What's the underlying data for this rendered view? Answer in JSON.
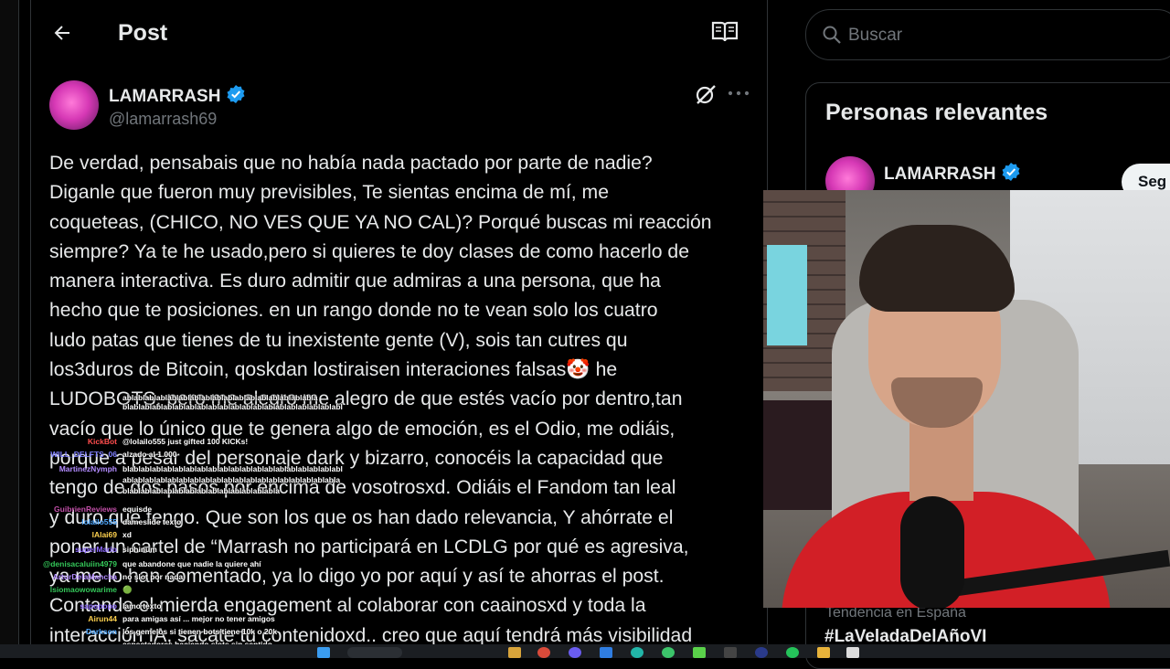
{
  "header": {
    "title": "Post"
  },
  "author": {
    "name": "LAMARRASH",
    "handle": "@lamarrash69"
  },
  "tweet": {
    "lines": [
      "De verdad, pensabais que no había nada pactado por parte  de  nadie?",
      "Diganle que fueron muy previsibles, Te sientas encima de mí, me",
      "coqueteas, (CHICO, NO VES QUE YA NO CAL)? Porqué buscas mi reacción",
      "siempre? Ya te he usado,pero si quieres te doy clases de como hacerlo de",
      "manera interactiva. Es duro admitir que admiras a una persona, que ha",
      "hecho que te posiciones. en un rango donde no te vean solo los cuatro",
      "ludo patas que tienes  de tu inexistente gente (V), sois tan cutres qu",
      "los3duros de Bitcoin, qoskdan  lostiraisen interaciones falsas🤡 he",
      "LUDOBOTS, pero me alegro me alegro de que estés vacío por dentro,tan",
      "vacío que lo único que te genera algo de emoción, es el Odio, me odiáis,",
      "porque a pesar del personaje dark y bizarro, conocéis la capacidad que",
      "tengo de dos pasos por encima de vosotrosxd. Odiáis el Fandom tan leal",
      "y duro que tengo. Que son los que os han dado relevancia, Y ahórrate el",
      "poner un cartel de “Marrash no participará en LCDLG por qué es agresiva,",
      "ya me lo han comentado, ya lo digo yo por aquí y así te ahorras el post.",
      "Contando el mierda engagement al colaborar con  caainosxd y toda la",
      "interacción IA, sacate tu contenidoxd.. creo que aquí tendrá más visibilidad"
    ]
  },
  "search": {
    "placeholder": "Buscar"
  },
  "relevant": {
    "title": "Personas relevantes",
    "person_name": "LAMARRASH",
    "follow_label": "Seg"
  },
  "trend": {
    "label": "Tendencia en España",
    "tag": "#LaVeladaDelAñoVI"
  },
  "chat": [
    {
      "user": "",
      "user_color": "#ffffff",
      "msg": "ablablablablablablablablablablablablablablablablabla"
    },
    {
      "user": "",
      "user_color": "#ffffff",
      "msg": "blablablablablablablablablablablablablablablablablablablabl"
    },
    {
      "user": "KickBot",
      "user_color": "#ff4d4d",
      "msg": "@lolailo555 just gifted 100 KICKs!"
    },
    {
      "user": "WILL_DELFTS_06",
      "user_color": "#7f7fff",
      "msg": "alzado al 1.000"
    },
    {
      "user": "MartinezNymph",
      "user_color": "#b38cff",
      "msg": "blablablablablablablablablablablablablablablablablablablabl"
    },
    {
      "user": "",
      "user_color": "#ffffff",
      "msg": "ablablablablablablablablablablablablablablablablablablabla"
    },
    {
      "user": "",
      "user_color": "#ffffff",
      "msg": "blablablablablablablablablablablablablabla"
    },
    {
      "user": "GuibrienReviews",
      "user_color": "#c24fa8",
      "msg": "equisde"
    },
    {
      "user": "lolailo555",
      "user_color": "#4fa8ff",
      "msg": "dameslide texto"
    },
    {
      "user": "lAlai69",
      "user_color": "#ffd24f",
      "msg": "xd"
    },
    {
      "user": "superMario",
      "user_color": "#8f6cff",
      "msg": "siphinum"
    },
    {
      "user": "@denisacaluiin4979",
      "user_color": "#34c759",
      "msg": "que abandone que nadie la quiere ahí"
    },
    {
      "user": "ArturDelaMancha",
      "user_color": "#b38cff",
      "msg": "no slot por nada"
    },
    {
      "user": "lsiomaowowarime",
      "user_color": "#34c759",
      "msg": "🟢"
    },
    {
      "user": "sapopopo",
      "user_color": "#8f6cff",
      "msg": "lamo texto"
    },
    {
      "user": "Airun44",
      "user_color": "#ffd24f",
      "msg": "para amigas así ... mejor no tener amigos"
    },
    {
      "user": "Darkson",
      "user_color": "#4fa8ff",
      "msg": "los gemelos si tienen bots tiene 10k o 20k"
    },
    {
      "user": "",
      "user_color": "#ffffff",
      "msg": "espectadores haciendo slots sin sentido"
    }
  ]
}
